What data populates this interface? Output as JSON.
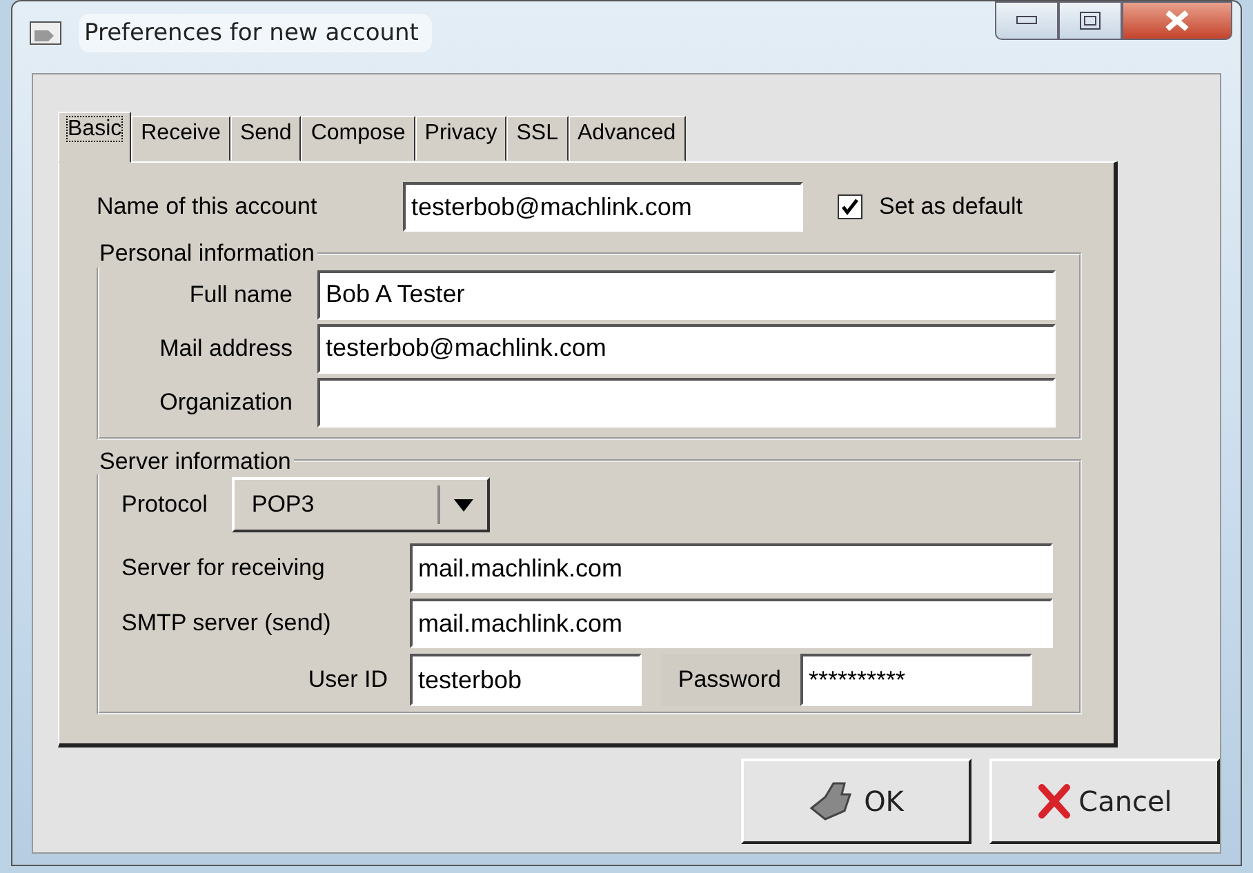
{
  "window": {
    "title": "Preferences for new account"
  },
  "tabs": [
    {
      "label": "Basic",
      "selected": true
    },
    {
      "label": "Receive",
      "selected": false
    },
    {
      "label": "Send",
      "selected": false
    },
    {
      "label": "Compose",
      "selected": false
    },
    {
      "label": "Privacy",
      "selected": false
    },
    {
      "label": "SSL",
      "selected": false
    },
    {
      "label": "Advanced",
      "selected": false
    }
  ],
  "account": {
    "label": "Name of this account",
    "value": "testerbob@machlink.com",
    "default_checkbox": {
      "label": "Set as default",
      "checked": true
    }
  },
  "personal": {
    "legend": "Personal information",
    "fields": [
      {
        "label": "Full name",
        "value": "Bob A Tester"
      },
      {
        "label": "Mail address",
        "value": "testerbob@machlink.com"
      },
      {
        "label": "Organization"
      }
    ]
  },
  "server": {
    "legend": "Server information",
    "protocol": {
      "label": "Protocol",
      "value": "POP3"
    },
    "fields": [
      {
        "label": "Server for receiving",
        "value": "mail.machlink.com"
      },
      {
        "label": "SMTP server (send)",
        "value": "mail.machlink.com"
      }
    ],
    "user_id": {
      "label": "User ID",
      "value": "testerbob"
    },
    "password": {
      "label": "Password",
      "value": "**********"
    }
  },
  "buttons": [
    {
      "label": "OK",
      "kind": "ok"
    },
    {
      "label": "Cancel",
      "kind": "cancel"
    }
  ]
}
